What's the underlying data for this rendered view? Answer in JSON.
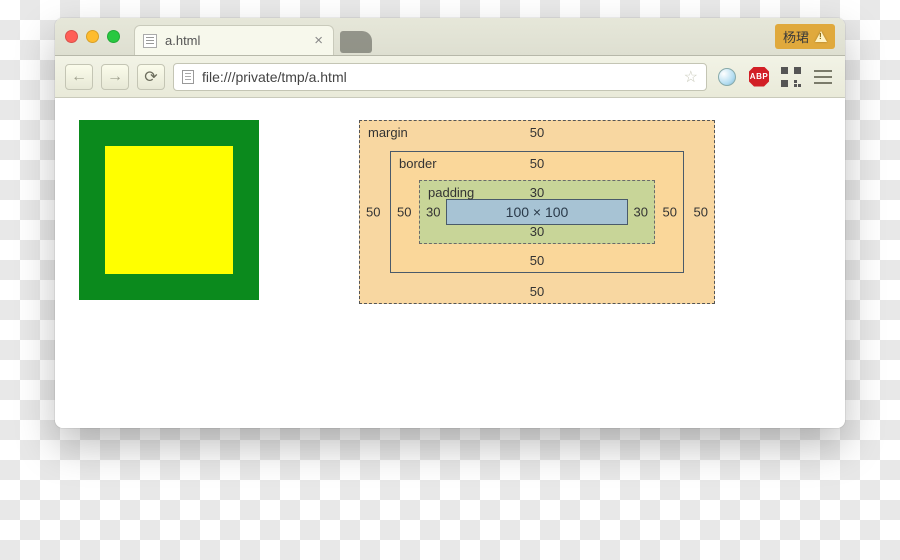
{
  "window": {
    "tab_title": "a.html",
    "user_badge": "杨珺"
  },
  "toolbar": {
    "url": "file:///private/tmp/a.html",
    "abp_label": "ABP"
  },
  "box_model": {
    "margin": {
      "label": "margin",
      "top": "50",
      "right": "50",
      "bottom": "50",
      "left": "50"
    },
    "border": {
      "label": "border",
      "top": "50",
      "right": "50",
      "bottom": "50",
      "left": "50"
    },
    "padding": {
      "label": "padding",
      "top": "30",
      "right": "30",
      "bottom": "30",
      "left": "30"
    },
    "content": {
      "label": "100 × 100"
    }
  }
}
